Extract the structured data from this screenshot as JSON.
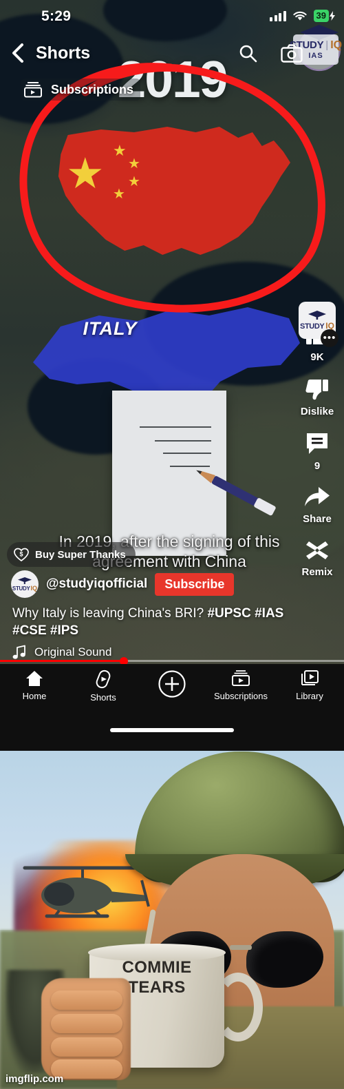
{
  "status_bar": {
    "time": "5:29",
    "battery_percent": "39",
    "signal_icon": "cellular-bars-icon",
    "wifi_icon": "wifi-icon",
    "charging_icon": "charging-bolt-icon"
  },
  "watermark": {
    "study": "STUDY",
    "divider": "|",
    "iq": "IQ",
    "ias": "IAS"
  },
  "top_bar": {
    "back_icon": "back-chevron-icon",
    "title": "Shorts",
    "search_icon": "search-icon",
    "camera_icon": "camera-icon"
  },
  "subscriptions_pill": {
    "icon": "subscriptions-icon",
    "label": "Subscriptions"
  },
  "video_overlay": {
    "year_text": "2019",
    "italy_label": "ITALY",
    "caption": "In 2019, after the signing of this agreement with China"
  },
  "action_rail": [
    {
      "icon": "thumbs-up-icon",
      "label": "9K",
      "name": "like-button"
    },
    {
      "icon": "thumbs-down-icon",
      "label": "Dislike",
      "name": "dislike-button"
    },
    {
      "icon": "comment-icon",
      "label": "9",
      "name": "comment-button"
    },
    {
      "icon": "share-icon",
      "label": "Share",
      "name": "share-button"
    },
    {
      "icon": "remix-icon",
      "label": "Remix",
      "name": "remix-button"
    }
  ],
  "super_thanks": {
    "icon": "super-thanks-heart-dollar-icon",
    "label": "Buy Super Thanks"
  },
  "channel": {
    "avatar_icon": "channel-avatar-icon",
    "avatar_study": "STUDY",
    "avatar_iq": "IQ",
    "handle": "@studyiqofficial",
    "subscribe_label": "Subscribe",
    "subscribe_color": "#e8362b"
  },
  "video_info": {
    "title_plain": "Why Italy is leaving China's BRI? ",
    "title_tags": "#UPSC #IAS #CSE #IPS",
    "sound_icon": "music-note-icon",
    "sound_label": "Original Sound"
  },
  "playback": {
    "progress_percent": 36,
    "progress_color": "#ff0000"
  },
  "bottom_nav": [
    {
      "icon": "home-icon",
      "label": "Home"
    },
    {
      "icon": "shorts-icon",
      "label": "Shorts"
    },
    {
      "icon": "create-plus-icon",
      "label": ""
    },
    {
      "icon": "subscriptions-icon",
      "label": "Subscriptions"
    },
    {
      "icon": "library-icon",
      "label": "Library"
    }
  ],
  "meme": {
    "mug_line1": "COMMIE",
    "mug_line2": "TEARS",
    "watermark": "imgflip.com"
  }
}
